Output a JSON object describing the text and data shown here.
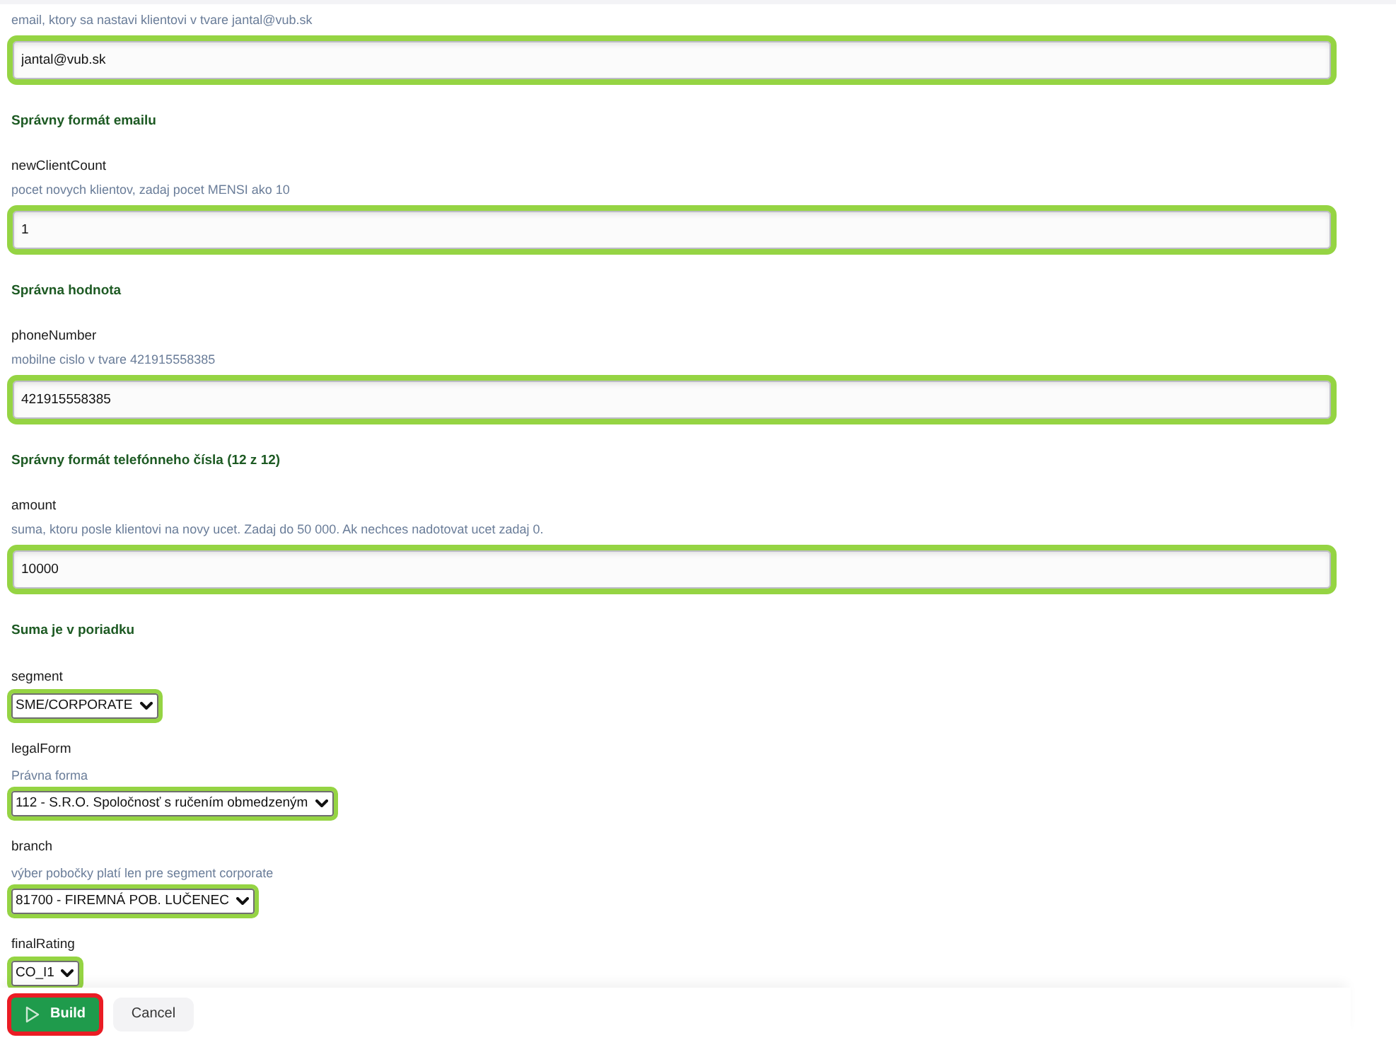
{
  "form": {
    "fields": [
      {
        "kind": "text",
        "help": "email, ktory sa nastavi klientovi v tvare jantal@vub.sk",
        "value": "jantal@vub.sk",
        "valid": true,
        "message": "Správny formát emailu"
      },
      {
        "kind": "text",
        "label": "newClientCount",
        "help": "pocet novych klientov, zadaj pocet MENSI ako 10",
        "value": "1",
        "valid": true,
        "message": "Správna hodnota"
      },
      {
        "kind": "text",
        "label": "phoneNumber",
        "help": "mobilne cislo v tvare 421915558385",
        "value": "421915558385",
        "valid": true,
        "message": "Správny formát telefónneho čísla (12 z 12)"
      },
      {
        "kind": "text",
        "label": "amount",
        "help": "suma, ktoru posle klientovi na novy ucet. Zadaj do 50 000. Ak nechces nadotovat ucet zadaj 0.",
        "value": "10000",
        "valid": true,
        "message": "Suma je v poriadku"
      },
      {
        "kind": "select",
        "label": "segment",
        "value": "SME/CORPORATE",
        "valid": true
      },
      {
        "kind": "select",
        "label": "legalForm",
        "help": "Právna forma",
        "value": "112 - S.R.O. Spoločnosť s ručením obmedzeným",
        "valid": true
      },
      {
        "kind": "select",
        "label": "branch",
        "help": "výber pobočky platí len pre segment corporate",
        "value": "81700 - FIREMNÁ POB. LUČENEC",
        "valid": true
      },
      {
        "kind": "select",
        "label": "finalRating",
        "value": "CO_I1",
        "valid": true
      }
    ]
  },
  "footer": {
    "buttons": [
      {
        "kind": "primary",
        "label": "Build",
        "highlighted": true
      },
      {
        "kind": "secondary",
        "label": "Cancel",
        "highlighted": false
      }
    ]
  }
}
